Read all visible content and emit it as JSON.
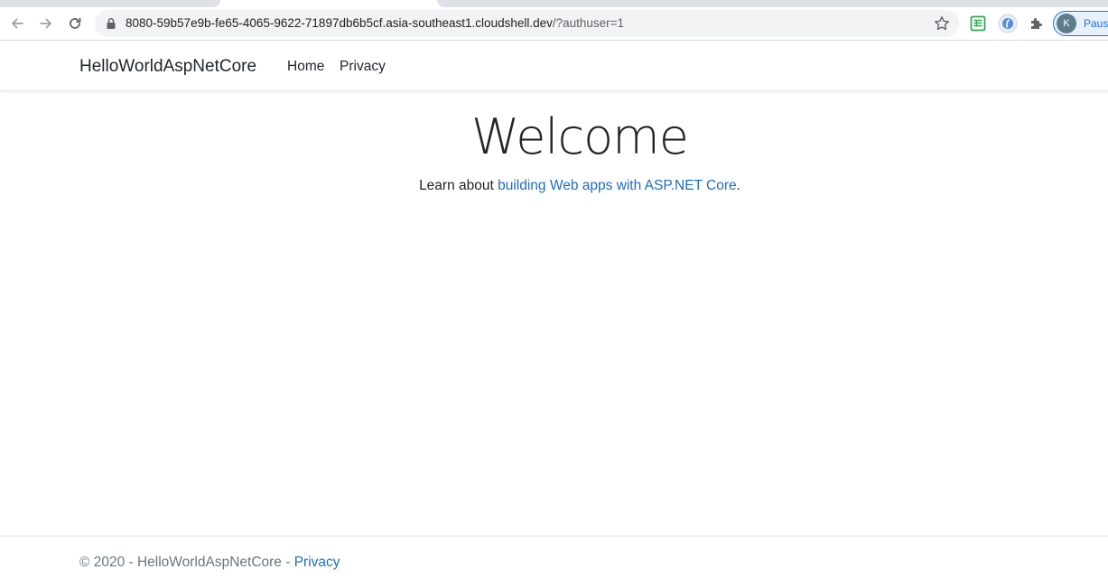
{
  "browser": {
    "url_main": "8080-59b57e9b-fe65-4065-9622-71897db6b5cf.asia-southeast1.cloudshell.dev",
    "url_rest": "/?authuser=1",
    "icons": {
      "back": "back-arrow-icon",
      "forward": "forward-arrow-icon",
      "reload": "reload-icon",
      "lock": "lock-icon",
      "bookmark": "star-icon",
      "extension_sheets": "sheets-extension-icon",
      "extension_round": "blue-extension-icon",
      "extensions_menu": "puzzle-icon"
    },
    "profile": {
      "initial": "K",
      "label": "Pause"
    },
    "colors": {
      "accent": "#1a73e8",
      "omnibox": "#f1f3f4"
    }
  },
  "site": {
    "brand": "HelloWorldAspNetCore",
    "nav": [
      {
        "label": "Home"
      },
      {
        "label": "Privacy"
      }
    ],
    "main": {
      "title": "Welcome",
      "lead_prefix": "Learn about ",
      "lead_link": "building Web apps with ASP.NET Core",
      "lead_suffix": "."
    },
    "footer": {
      "text": "© 2020 - HelloWorldAspNetCore - ",
      "link": "Privacy"
    },
    "colors": {
      "link": "#1b6ec2",
      "text": "#212529",
      "muted": "#6c757d"
    }
  }
}
